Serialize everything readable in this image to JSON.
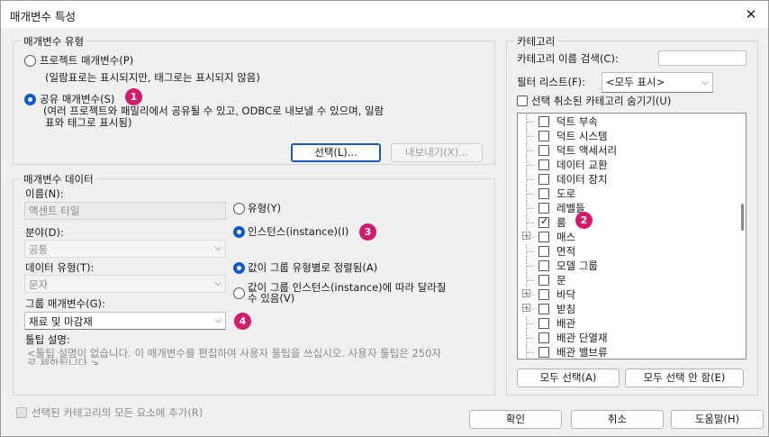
{
  "window": {
    "title": "매개변수 특성",
    "close_icon": "close-icon"
  },
  "param_type": {
    "group_label": "매개변수 유형",
    "project_label": "프로젝트 매개변수(P)",
    "project_desc": "(일람표로는 표시되지만, 태그로는 표시되지 않음)",
    "shared_label": "공유 매개변수(S)",
    "shared_desc_1": "(여러 프로젝트와 패밀리에서 공유될 수 있고, ODBC로 내보낼 수 있으며, 일람",
    "shared_desc_2": "표와 태그로 표시됨)",
    "select_button": "선택(L)...",
    "export_button": "내보내기(X)...",
    "selected": "shared"
  },
  "param_data": {
    "group_label": "매개변수 데이터",
    "name_label": "이름(N):",
    "name_value": "액센트 타일",
    "discipline_label": "분야(D):",
    "discipline_value": "공통",
    "datatype_label": "데이터 유형(T):",
    "datatype_value": "문자",
    "groupparam_label": "그룹 매개변수(G):",
    "groupparam_value": "재료 및 마감재",
    "tooltip_label": "툴팁 설명:",
    "tooltip_text": "<툴팁 설명이 없습니다. 이 매개변수를 편집하여 사용자 툴팁을 쓰십시오. 사용자 툴팁은 250자",
    "tooltip_text_2": "로 제한됩니다.>",
    "type_label": "유형(Y)",
    "instance_label": "인스턴스(instance)(I)",
    "align_group_label": "값이 그룹 유형별로 정렬됨(A)",
    "vary_label_1": "값이 그룹 인스턴스(instance)에 따라 달라질",
    "vary_label_2": "수 있음(V)"
  },
  "category": {
    "group_label": "카테고리",
    "filter_name_label": "카테고리 이름 검색(C):",
    "filter_list_label": "필터 리스트(F):",
    "filter_list_value": "<모두 표시>",
    "hide_unchecked_label": "선택 취소된 카테고리 숨기기(U)",
    "items": [
      {
        "label": "덕트 부속",
        "checked": false,
        "expandable": false
      },
      {
        "label": "덕트 시스템",
        "checked": false,
        "expandable": false
      },
      {
        "label": "덕트 액세서리",
        "checked": false,
        "expandable": false
      },
      {
        "label": "데이터 교환",
        "checked": false,
        "expandable": false
      },
      {
        "label": "데이터 장치",
        "checked": false,
        "expandable": false
      },
      {
        "label": "도로",
        "checked": false,
        "expandable": false
      },
      {
        "label": "레벨들",
        "checked": false,
        "expandable": false
      },
      {
        "label": "룸",
        "checked": true,
        "expandable": false
      },
      {
        "label": "매스",
        "checked": false,
        "expandable": true
      },
      {
        "label": "면적",
        "checked": false,
        "expandable": false
      },
      {
        "label": "모델 그룹",
        "checked": false,
        "expandable": false
      },
      {
        "label": "문",
        "checked": false,
        "expandable": false
      },
      {
        "label": "바닥",
        "checked": false,
        "expandable": true
      },
      {
        "label": "받침",
        "checked": false,
        "expandable": true
      },
      {
        "label": "배관",
        "checked": false,
        "expandable": false
      },
      {
        "label": "배관 단열재",
        "checked": false,
        "expandable": false
      },
      {
        "label": "배관 밸브류",
        "checked": false,
        "expandable": false
      }
    ],
    "check_all_button": "모두 선택(A)",
    "check_none_button": "모두 선택 안 함(E)"
  },
  "footer": {
    "add_all_label": "선택된 카테고리의 모든 요소에 추가(R)",
    "ok_button": "확인",
    "cancel_button": "취소",
    "help_button": "도움말(H)"
  },
  "badges": {
    "b1": "1",
    "b2": "2",
    "b3": "3",
    "b4": "4"
  },
  "colors": {
    "accent": "#0b5cc9",
    "badge": "#d41a6b"
  }
}
